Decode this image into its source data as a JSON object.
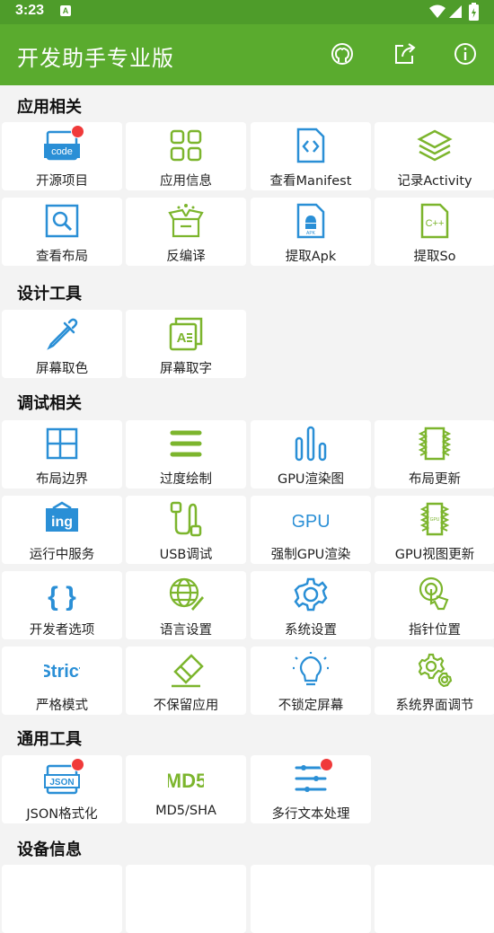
{
  "status": {
    "time": "3:23",
    "notif_icon": "A"
  },
  "app": {
    "title": "开发助手专业版"
  },
  "actions": [
    {
      "name": "github-icon"
    },
    {
      "name": "share-icon"
    },
    {
      "name": "info-icon"
    }
  ],
  "sections": [
    {
      "title": "应用相关",
      "items": [
        {
          "label": "开源项目",
          "icon": "code-icon",
          "badge": true
        },
        {
          "label": "应用信息",
          "icon": "grid-icon"
        },
        {
          "label": "查看Manifest",
          "icon": "manifest-file-icon"
        },
        {
          "label": "记录Activity",
          "icon": "layers-icon"
        },
        {
          "label": "查看布局",
          "icon": "layout-search-icon"
        },
        {
          "label": "反编译",
          "icon": "box-icon"
        },
        {
          "label": "提取Apk",
          "icon": "apk-file-icon"
        },
        {
          "label": "提取So",
          "icon": "cpp-file-icon"
        }
      ]
    },
    {
      "title": "设计工具",
      "items": [
        {
          "label": "屏幕取色",
          "icon": "eyedropper-icon"
        },
        {
          "label": "屏幕取字",
          "icon": "text-capture-icon"
        }
      ]
    },
    {
      "title": "调试相关",
      "items": [
        {
          "label": "布局边界",
          "icon": "layout-bounds-icon"
        },
        {
          "label": "过度绘制",
          "icon": "menu-lines-icon"
        },
        {
          "label": "GPU渲染图",
          "icon": "bar-chart-icon"
        },
        {
          "label": "布局更新",
          "icon": "layout-update-icon"
        },
        {
          "label": "运行中服务",
          "icon": "ing-icon"
        },
        {
          "label": "USB调试",
          "icon": "usb-icon"
        },
        {
          "label": "强制GPU渲染",
          "icon": "gpu-icon"
        },
        {
          "label": "GPU视图更新",
          "icon": "gpu-chip-icon"
        },
        {
          "label": "开发者选项",
          "icon": "braces-icon"
        },
        {
          "label": "语言设置",
          "icon": "globe-icon"
        },
        {
          "label": "系统设置",
          "icon": "gear-icon"
        },
        {
          "label": "指针位置",
          "icon": "touch-icon"
        },
        {
          "label": "严格模式",
          "icon": "strict-icon"
        },
        {
          "label": "不保留应用",
          "icon": "eraser-icon"
        },
        {
          "label": "不锁定屏幕",
          "icon": "bulb-icon"
        },
        {
          "label": "系统界面调节",
          "icon": "gears-icon"
        }
      ]
    },
    {
      "title": "通用工具",
      "items": [
        {
          "label": "JSON格式化",
          "icon": "json-icon",
          "badge": true
        },
        {
          "label": "MD5/SHA",
          "icon": "md5-icon"
        },
        {
          "label": "多行文本处理",
          "icon": "text-lines-icon",
          "badge": true
        }
      ]
    },
    {
      "title": "设备信息",
      "items": []
    }
  ],
  "icon_texts": {
    "code": "code",
    "ing": "ing",
    "gpu": "GPU",
    "strict": "Strict",
    "json": "JSON",
    "md5": "MD5",
    "cpp": "C++",
    "apk": "APK",
    "gpu_chip": "GPU"
  },
  "colors": {
    "statusbar": "#4e9c2a",
    "appbar": "#5aab2e",
    "blue": "#2a8fd6",
    "green": "#7cb52d",
    "badge": "#f03a3a"
  }
}
